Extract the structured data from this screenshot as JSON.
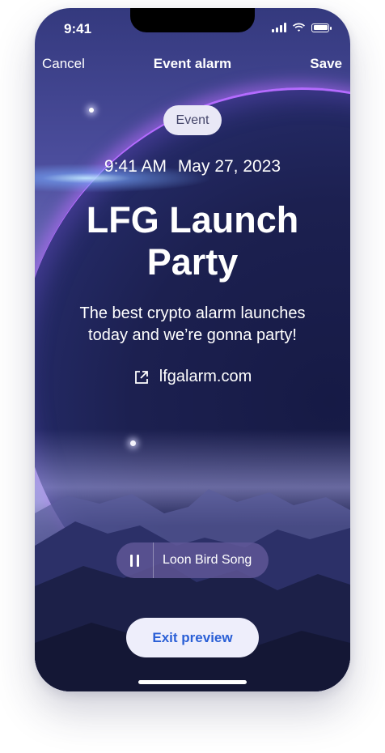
{
  "status_bar": {
    "time": "9:41",
    "icons": [
      "cellular-signal-icon",
      "wifi-icon",
      "battery-icon"
    ]
  },
  "nav": {
    "cancel_label": "Cancel",
    "title": "Event alarm",
    "save_label": "Save"
  },
  "event": {
    "tag": "Event",
    "time": "9:41 AM",
    "date": "May 27, 2023",
    "title_line1": "LFG Launch",
    "title_line2": "Party",
    "description_line1": "The best crypto alarm launches",
    "description_line2": "today and we’re gonna party!",
    "link_icon": "external-link-icon",
    "link_text": "lfgalarm.com"
  },
  "audio": {
    "control_icon": "pause-icon",
    "song_name": "Loon Bird Song"
  },
  "exit_button": {
    "label": "Exit preview"
  },
  "colors": {
    "accent_blue": "#2a5fd6",
    "pill_bg": "#e9e8f6",
    "audio_pill_bg": "#5f5696",
    "planet_rim": "#b46bff"
  }
}
